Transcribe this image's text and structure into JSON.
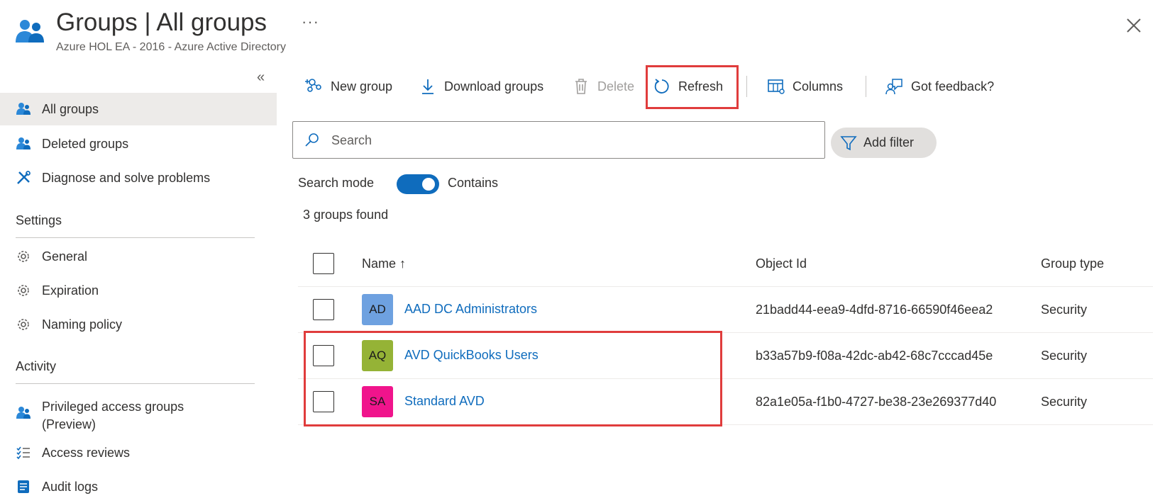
{
  "header": {
    "title": "Groups | All groups",
    "more": "···",
    "subtitle": "Azure HOL EA - 2016 - Azure Active Directory"
  },
  "sidebar": {
    "collapse": "«",
    "items": [
      {
        "label": "All groups",
        "icon": "group-icon",
        "active": true
      },
      {
        "label": "Deleted groups",
        "icon": "group-icon"
      },
      {
        "label": "Diagnose and solve problems",
        "icon": "wrench-cross-icon"
      }
    ],
    "settings_header": "Settings",
    "settings_items": [
      {
        "label": "General",
        "icon": "gear-icon"
      },
      {
        "label": "Expiration",
        "icon": "gear-icon"
      },
      {
        "label": "Naming policy",
        "icon": "gear-icon"
      }
    ],
    "activity_header": "Activity",
    "activity_items": [
      {
        "label_line1": "Privileged access groups",
        "label_line2": "(Preview)",
        "icon": "group-icon"
      },
      {
        "label": "Access reviews",
        "icon": "checklist-icon"
      },
      {
        "label": "Audit logs",
        "icon": "log-icon"
      }
    ]
  },
  "toolbar": {
    "new_group": "New group",
    "download_groups": "Download groups",
    "delete": "Delete",
    "refresh": "Refresh",
    "columns": "Columns",
    "feedback": "Got feedback?"
  },
  "search": {
    "placeholder": "Search",
    "add_filter": "Add filter",
    "mode_label": "Search mode",
    "mode_value": "Contains"
  },
  "results": {
    "count_text": "3 groups found",
    "columns": [
      "Name ↑",
      "Object Id",
      "Group type"
    ],
    "rows": [
      {
        "initials": "AD",
        "color": "#6ea1e0",
        "name": "AAD DC Administrators",
        "object_id": "21badd44-eea9-4dfd-8716-66590f46eea2",
        "type": "Security"
      },
      {
        "initials": "AQ",
        "color": "#95b336",
        "name": "AVD QuickBooks Users",
        "object_id": "b33a57b9-f08a-42dc-ab42-68c7cccad45e",
        "type": "Security"
      },
      {
        "initials": "SA",
        "color": "#f0148c",
        "name": "Standard AVD",
        "object_id": "82a1e05a-f1b0-4727-be38-23e269377d40",
        "type": "Security"
      }
    ]
  },
  "colors": {
    "accent": "#0f6cbd",
    "highlight": "#e03c3c",
    "active_nav": "#edebe9"
  }
}
